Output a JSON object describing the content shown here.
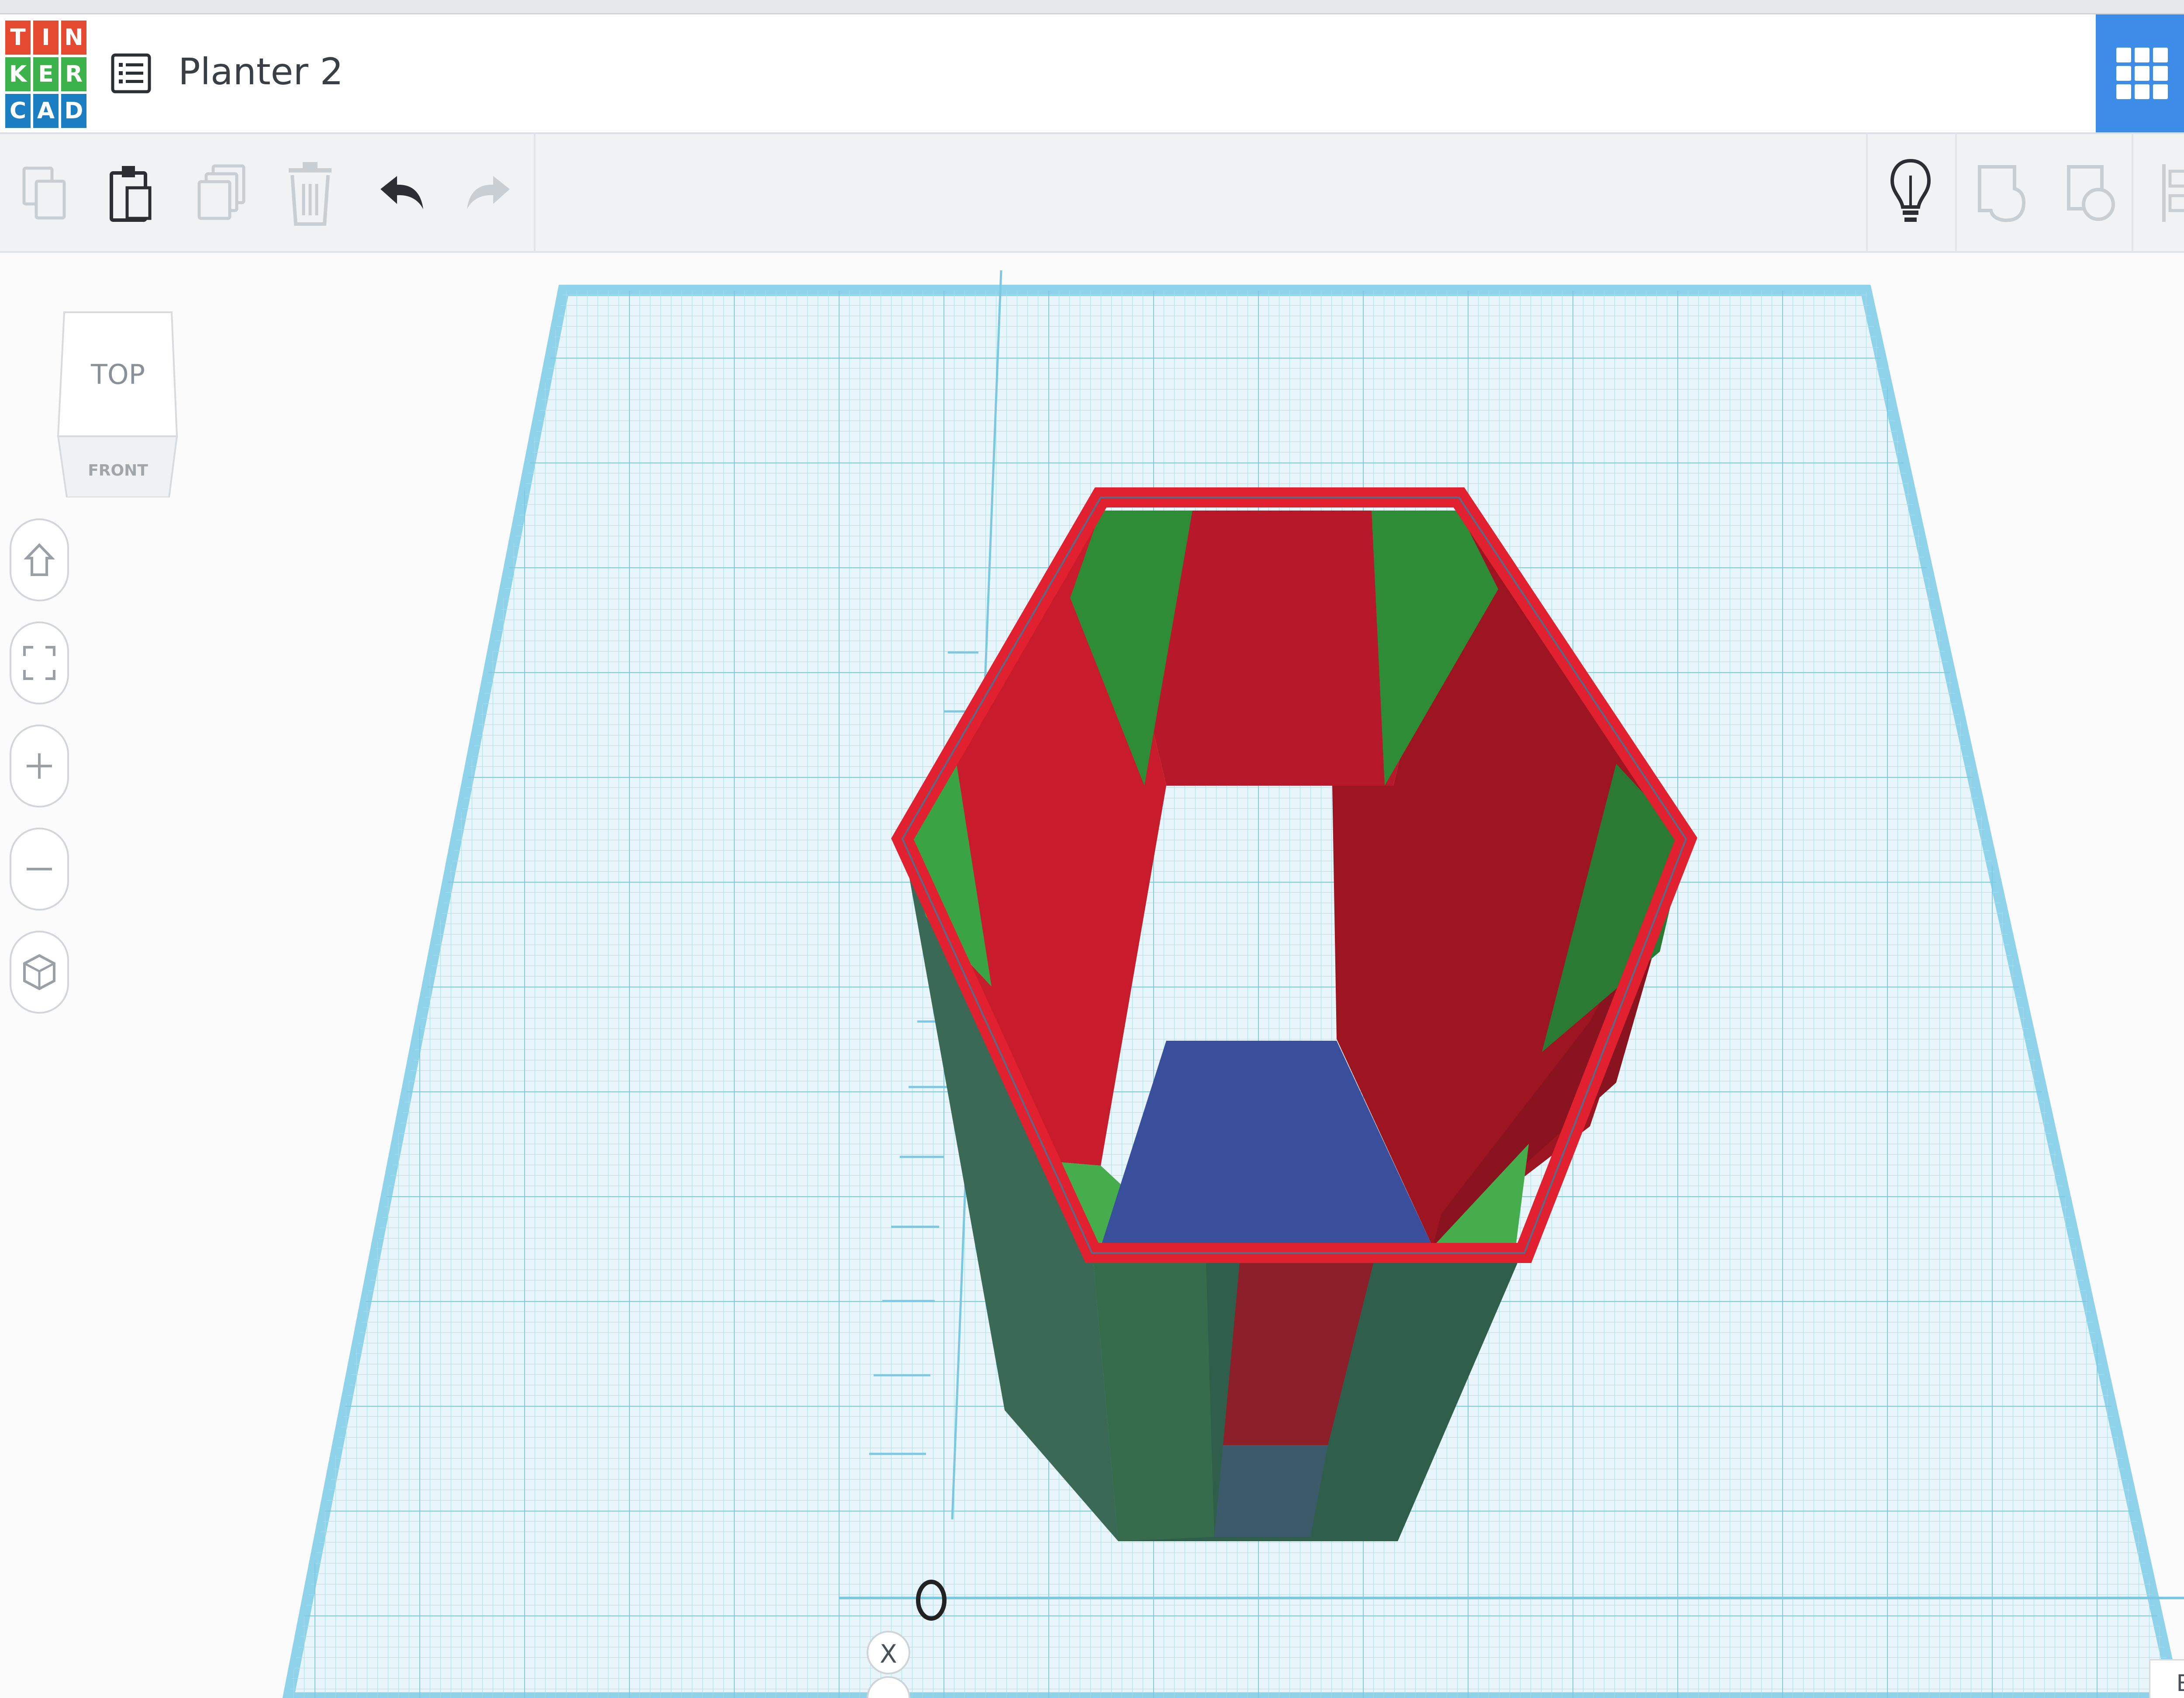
{
  "app": {
    "logo_letters": [
      "T",
      "I",
      "N",
      "K",
      "E",
      "R",
      "C",
      "A",
      "D"
    ],
    "logo_colors": [
      "#e5492f",
      "#e5492f",
      "#e5492f",
      "#3bb24a",
      "#3bb24a",
      "#3bb24a",
      "#1b7ec2",
      "#1b7ec2",
      "#1b7ec2"
    ],
    "document_title": "Planter 2"
  },
  "header": {
    "design_list_icon": "list-icon",
    "view_grid_icon": "grid-icon",
    "view_blocks_icon": "pickaxe-icon",
    "accent_color": "#3d8ce8"
  },
  "toolbar": {
    "copy_icon": "copy-icon",
    "paste_icon": "paste-icon",
    "duplicate_icon": "duplicate-icon",
    "delete_icon": "trash-icon",
    "undo_icon": "undo-icon",
    "redo_icon": "redo-icon",
    "notes_icon": "lightbulb-icon",
    "group_icon": "group-icon",
    "ungroup_icon": "ungroup-icon",
    "align_icon": "align-icon",
    "mirror_icon": "mirror-icon"
  },
  "viewcube": {
    "top_label": "TOP",
    "front_label": "FRONT"
  },
  "navigation": {
    "home_icon": "home-icon",
    "fit_icon": "fit-view-icon",
    "zoom_in_icon": "zoom-in-icon",
    "zoom_out_icon": "zoom-out-icon",
    "perspective_icon": "perspective-icon"
  },
  "workplane": {
    "origin_label": "0",
    "axis_label": "X",
    "edit_grid_label": "Edit Grid",
    "grid_color": "#8fd3ea",
    "planter_colors": {
      "rim": "#e1212f",
      "inner_wall": "#c21826",
      "side": "#2e8b36",
      "floor": "#3a4f9c",
      "outer_wall": "#2f5f4a"
    }
  }
}
